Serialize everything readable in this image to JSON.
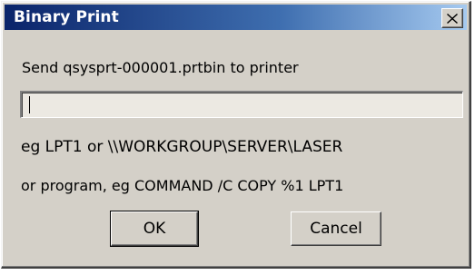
{
  "window": {
    "title": "Binary Print",
    "close_icon": "close-icon"
  },
  "prompt": "Send qsysprt-000001.prtbin to printer",
  "path_field": {
    "value": "",
    "placeholder": ""
  },
  "examples": {
    "line1": "eg  LPT1  or  \\\\WORKGROUP\\SERVER\\LASER",
    "line2": "or program, eg  COMMAND /C COPY %1 LPT1"
  },
  "buttons": {
    "ok": "OK",
    "cancel": "Cancel"
  },
  "colors": {
    "face": "#d4d0c8",
    "title_start": "#0a246a",
    "title_end": "#a6caf0"
  }
}
